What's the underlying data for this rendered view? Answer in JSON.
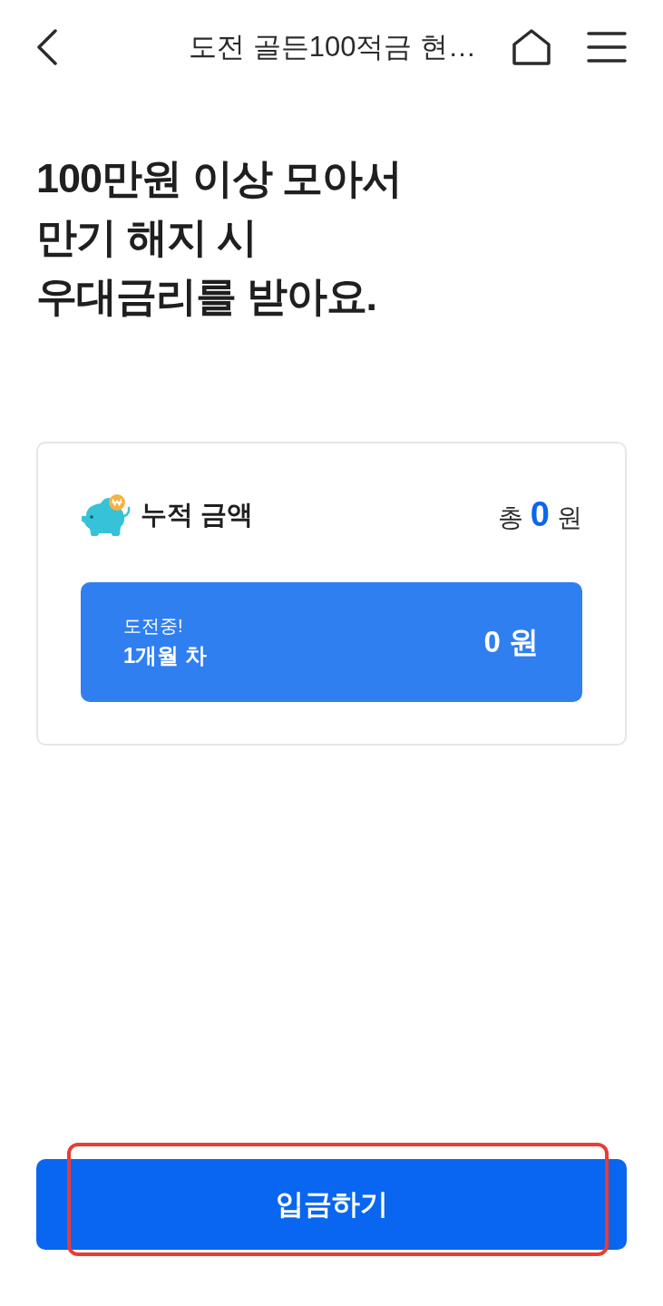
{
  "header": {
    "title": "도전 골든100적금 현…"
  },
  "headline": {
    "lines": [
      "100만원 이상 모아서",
      "만기 해지 시",
      "우대금리를 받아요."
    ]
  },
  "summary_card": {
    "label": "누적 금액",
    "total_prefix": "총",
    "total_amount": "0",
    "total_unit": "원",
    "challenge": {
      "status": "도전중!",
      "period": "1개월 차",
      "amount": "0 원"
    }
  },
  "deposit_button": {
    "label": "입금하기",
    "highlighted": true
  }
}
